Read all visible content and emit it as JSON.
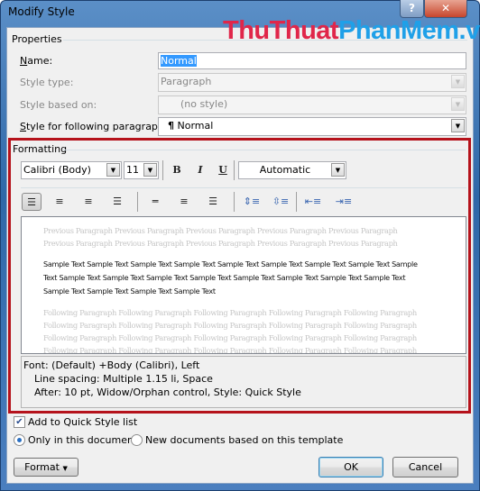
{
  "window": {
    "title": "Modify Style",
    "help_label": "?",
    "close_label": "✕"
  },
  "watermark": {
    "part1": "ThuThuat",
    "part2": "PhanMem.vn"
  },
  "properties": {
    "group_label": "Properties",
    "name_label": "Name:",
    "name_value": "Normal",
    "style_type_label": "Style type:",
    "style_type_value": "Paragraph",
    "based_on_label": "Style based on:",
    "based_on_value": "(no style)",
    "following_label": "Style for following paragraph:",
    "following_value": "Normal",
    "following_icon": "¶"
  },
  "formatting": {
    "group_label": "Formatting",
    "font": "Calibri (Body)",
    "size": "11",
    "bold": "B",
    "italic": "I",
    "underline": "U",
    "color": "Automatic",
    "preview": {
      "previous": "Previous Paragraph Previous Paragraph Previous Paragraph Previous Paragraph Previous Paragraph Previous Paragraph Previous Paragraph Previous Paragraph Previous Paragraph Previous Paragraph",
      "sample": "Sample Text Sample Text Sample Text Sample Text Sample Text Sample Text Sample Text Sample Text Sample Text Sample Text Sample Text Sample Text Sample Text Sample Text Sample Text Sample Text Sample Text Sample Text Sample Text Sample Text Sample Text",
      "following": "Following Paragraph Following Paragraph Following Paragraph Following Paragraph Following Paragraph Following Paragraph Following Paragraph Following Paragraph Following Paragraph Following Paragraph Following Paragraph Following Paragraph Following Paragraph Following Paragraph Following Paragraph Following Paragraph Following Paragraph Following Paragraph Following Paragraph Following Paragraph"
    },
    "description": {
      "line1": "Font: (Default) +Body (Calibri), Left",
      "line2": "Line spacing:  Multiple 1.15 li, Space",
      "line3": "After:  10 pt, Widow/Orphan control, Style: Quick Style"
    }
  },
  "options": {
    "add_quick_style": "Add to Quick Style list",
    "add_quick_style_checked": true,
    "only_this_doc": "Only in this document",
    "new_docs": "New documents based on this template",
    "selected": "only_this_doc"
  },
  "buttons": {
    "format": "Format",
    "ok": "OK",
    "cancel": "Cancel"
  },
  "colors": {
    "highlight_border": "#b5121b",
    "frame": "#2f68a8"
  }
}
